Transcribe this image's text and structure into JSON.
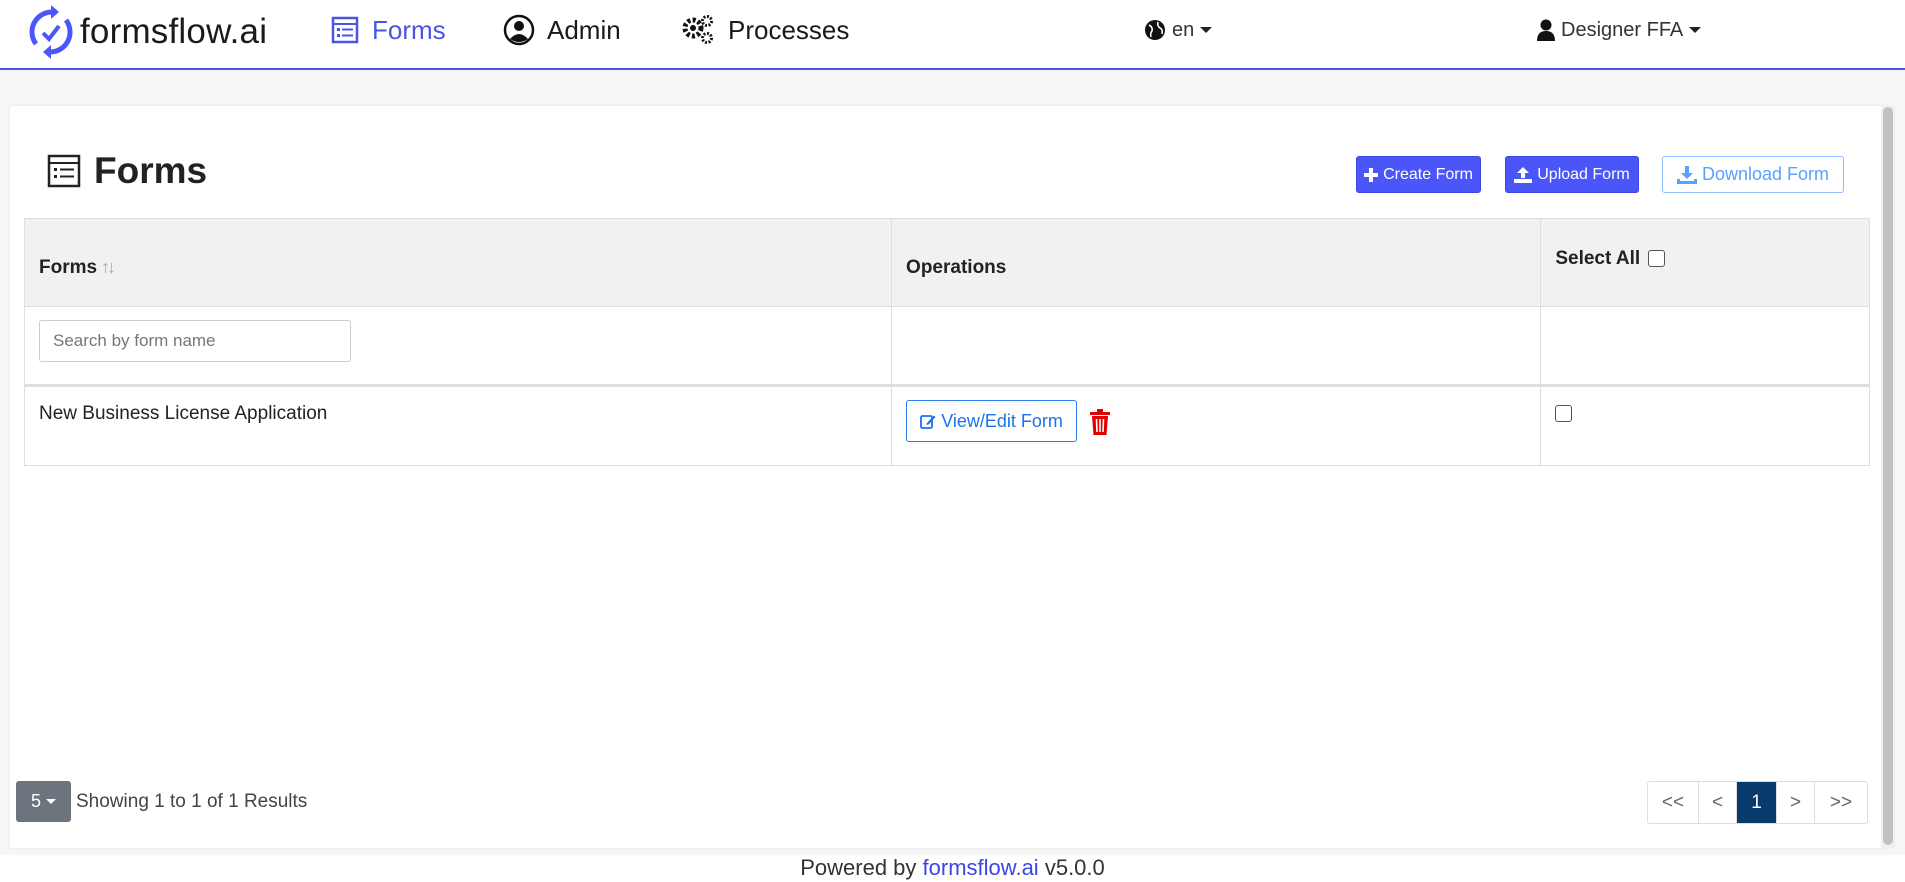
{
  "brand": {
    "name": "formsflow.ai",
    "logo_icon": "sync-icon"
  },
  "nav": {
    "items": [
      {
        "label": "Forms",
        "icon": "form-icon",
        "active": true
      },
      {
        "label": "Admin",
        "icon": "user-circle-icon",
        "active": false
      },
      {
        "label": "Processes",
        "icon": "gears-icon",
        "active": false
      }
    ],
    "language": "en",
    "user": "Designer FFA"
  },
  "page": {
    "title": "Forms",
    "buttons": {
      "create": "Create Form",
      "upload": "Upload Form",
      "download": "Download Form"
    }
  },
  "table": {
    "columns": [
      "Forms",
      "Operations",
      "Select All"
    ],
    "sort_icon": "↑↓",
    "search_placeholder": "Search by form name",
    "rows": [
      {
        "name": "New Business License Application",
        "action": "View/Edit Form"
      }
    ]
  },
  "pagination": {
    "page_size": "5",
    "summary": "Showing 1 to 1 of 1 Results",
    "buttons": [
      "<<",
      "<",
      "1",
      ">",
      ">>"
    ],
    "current": "1"
  },
  "footer": {
    "prefix": "Powered by",
    "link": "formsflow.ai",
    "version": "v5.0.0"
  },
  "colors": {
    "accent": "#4a56f7",
    "active_page": "#083b6b",
    "danger": "#e00000"
  }
}
